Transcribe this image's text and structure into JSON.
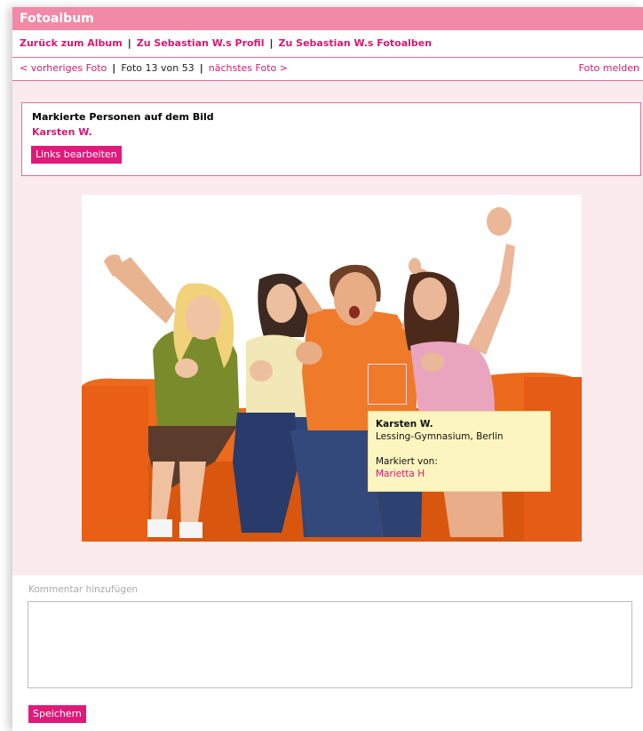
{
  "header": {
    "title": "Fotoalbum"
  },
  "nav": {
    "back_to_album": "Zurück zum Album",
    "to_profile": "Zu Sebastian W.s Profil",
    "to_albums": "Zu Sebastian W.s Fotoalben",
    "separator": "|"
  },
  "photo_nav": {
    "prev": "< vorheriges Foto",
    "counter": "Foto 13 von 53",
    "next": "nächstes Foto >",
    "report": "Foto melden",
    "separator": "|"
  },
  "tags": {
    "heading": "Markierte Personen auf dem Bild",
    "person": "Karsten W.",
    "edit_button": "Links bearbeiten"
  },
  "tooltip": {
    "name": "Karsten W.",
    "school": "Lessing-Gymnasium, Berlin",
    "tagged_by_label": "Markiert von:",
    "tagged_by": "Marietta H"
  },
  "comment": {
    "label": "Kommentar hinzufügen",
    "value": "",
    "save_button": "Speichern"
  },
  "colors": {
    "accent": "#e0197b",
    "header": "#f189a7",
    "panel_bg": "#fbeaee",
    "tooltip_bg": "#fdf5bf"
  }
}
